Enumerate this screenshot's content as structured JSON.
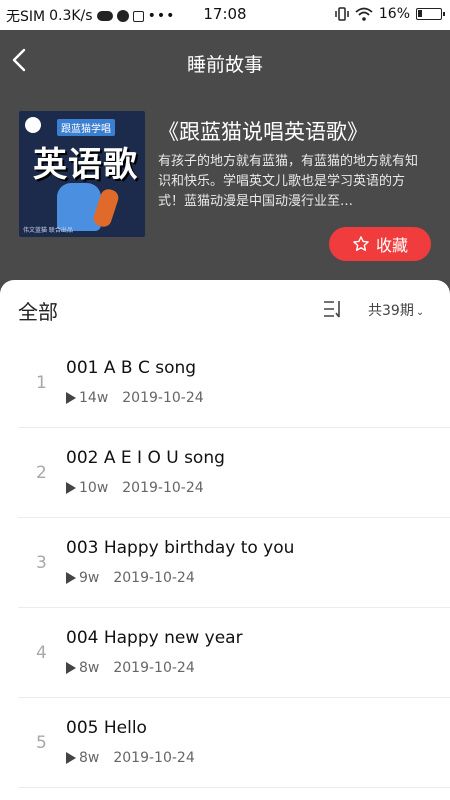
{
  "status_bar": {
    "carrier": "无SIM",
    "speed": "0.3K/s",
    "time": "17:08",
    "battery": "16%"
  },
  "header": {
    "title": "睡前故事",
    "back_icon": "chevron-left-icon"
  },
  "album": {
    "cover_small_title": "跟蓝猫学唱",
    "cover_big_title": "英语歌",
    "cover_footer": "伟文蓝猫  联合出品",
    "name": "《跟蓝猫说唱英语歌》",
    "description": "有孩子的地方就有蓝猫，有蓝猫的地方就有知识和快乐。学唱英文儿歌也是学习英语的方式！蓝猫动漫是中国动漫行业至…",
    "favorite_label": "收藏",
    "favorite_icon": "star-outline-icon",
    "accent_color": "#f03c3c"
  },
  "list_header": {
    "all_label": "全部",
    "sort_icon": "sort-icon",
    "count_label": "共39期"
  },
  "episodes": [
    {
      "index": "1",
      "title": "001 A B C song",
      "plays": "14w",
      "date": "2019-10-24"
    },
    {
      "index": "2",
      "title": "002 A E I O U song",
      "plays": "10w",
      "date": "2019-10-24"
    },
    {
      "index": "3",
      "title": "003 Happy birthday to you",
      "plays": "9w",
      "date": "2019-10-24"
    },
    {
      "index": "4",
      "title": "004 Happy new year",
      "plays": "8w",
      "date": "2019-10-24"
    },
    {
      "index": "5",
      "title": "005 Hello",
      "plays": "8w",
      "date": "2019-10-24"
    }
  ]
}
